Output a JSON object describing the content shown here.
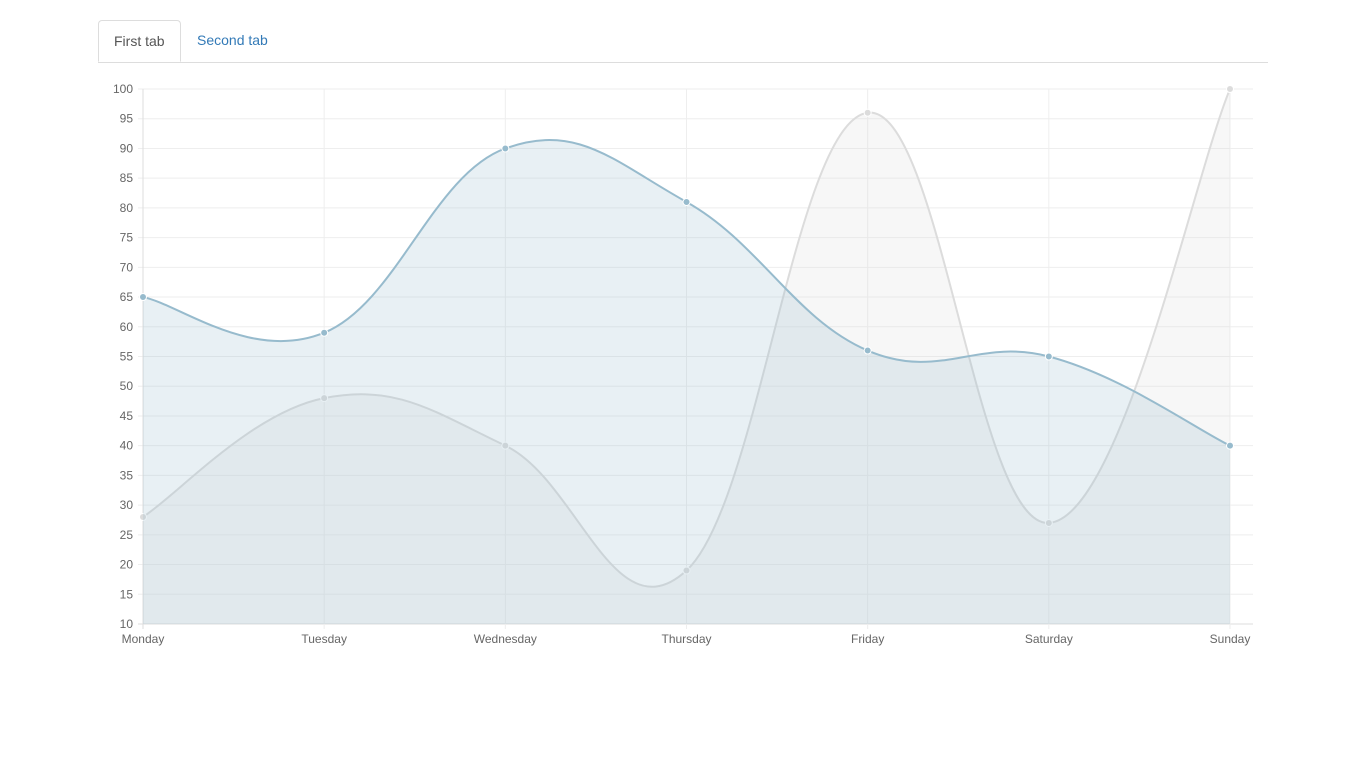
{
  "tabs": [
    {
      "label": "First tab",
      "active": true
    },
    {
      "label": "Second tab",
      "active": false
    }
  ],
  "colors": {
    "series1_line": "#97bbcd",
    "series1_fill": "rgba(151,187,205,0.22)",
    "series2_line": "#dcdcdc",
    "series2_fill": "rgba(220,220,220,0.22)",
    "grid": "#eeeeee",
    "axis": "#dddddd",
    "tab_link": "#337ab7"
  },
  "chart_data": {
    "type": "area",
    "categories": [
      "Monday",
      "Tuesday",
      "Wednesday",
      "Thursday",
      "Friday",
      "Saturday",
      "Sunday"
    ],
    "series": [
      {
        "values": [
          28,
          48,
          40,
          19,
          96,
          27,
          100
        ]
      },
      {
        "values": [
          65,
          59,
          90,
          81,
          56,
          55,
          40
        ]
      }
    ],
    "yticks": [
      "10",
      "15",
      "20",
      "25",
      "30",
      "35",
      "40",
      "45",
      "50",
      "55",
      "60",
      "65",
      "70",
      "75",
      "80",
      "85",
      "90",
      "95",
      "100"
    ],
    "ylim": [
      10,
      100
    ],
    "grid": true,
    "curve": "smooth"
  }
}
